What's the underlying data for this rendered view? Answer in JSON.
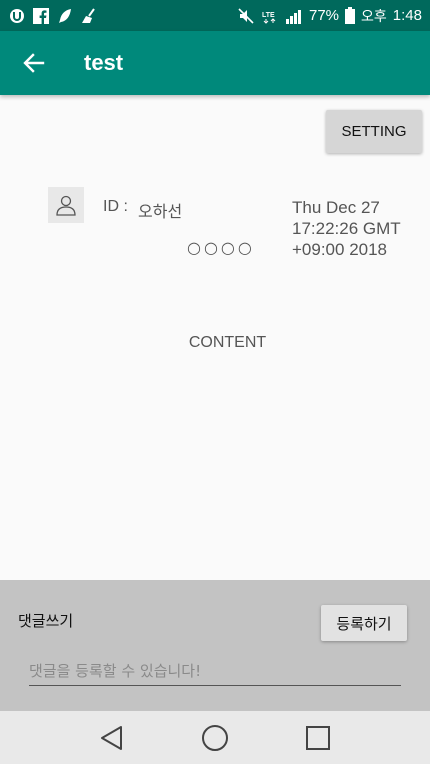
{
  "status_bar": {
    "battery_percent": "77%",
    "am_pm": "오후",
    "time": "1:48",
    "lte_label": "LTE",
    "left_icons": [
      "u-logo-icon",
      "facebook-icon",
      "feather-icon",
      "broom-icon"
    ],
    "right_icons": [
      "mute-icon",
      "lte-icon",
      "signal-icon",
      "battery-icon"
    ]
  },
  "app_bar": {
    "title": "test",
    "back_icon": "arrow-left-icon",
    "color": "#00897b"
  },
  "post": {
    "setting_label": "SETTING",
    "id_label": "ID :",
    "author": "오하선",
    "rating": "○○○○",
    "date": "Thu Dec 27 17:22:26 GMT +09:00 2018",
    "content": "CONTENT",
    "avatar_icon": "person-icon"
  },
  "comment": {
    "label": "댓글쓰기",
    "register_label": "등록하기",
    "input_value": "",
    "placeholder": "댓글을 등록할 수 있습니다!"
  },
  "nav_bar": {
    "icons": [
      "back-triangle-icon",
      "home-circle-icon",
      "recents-square-icon"
    ]
  }
}
